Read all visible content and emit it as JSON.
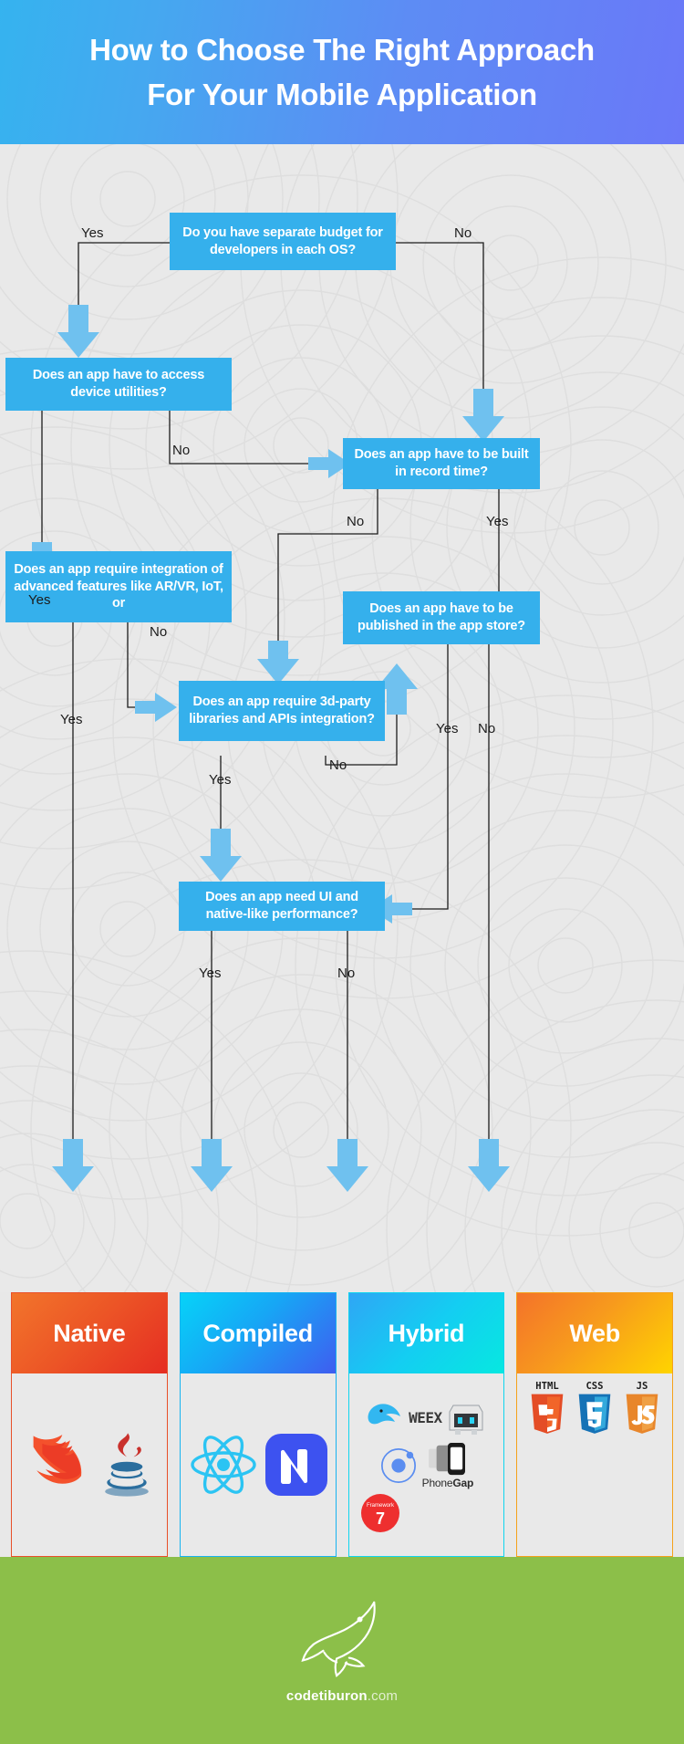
{
  "header": {
    "line1": "How to Choose The Right Approach",
    "line2": "For Your Mobile Application",
    "gradient_from": "#35b3ef",
    "gradient_to": "#6a78f8"
  },
  "flow": {
    "node_color": "#35b0ec",
    "arrow_color": "#6fc1ef",
    "nodes": [
      {
        "id": "budget",
        "text": "Do you have separate budget for developers in each OS?"
      },
      {
        "id": "utilities",
        "text": "Does an app have to access device utilities?"
      },
      {
        "id": "record",
        "text": "Does an app have to be built in record time?"
      },
      {
        "id": "advanced",
        "text": "Does an app require integration of advanced features like AR/VR, IoT, or"
      },
      {
        "id": "store",
        "text": "Does an app have to be published in the app store?"
      },
      {
        "id": "thirdparty",
        "text": "Does an app require 3d-party libraries and APIs integration?"
      },
      {
        "id": "ui",
        "text": "Does an app need UI and native-like performance?"
      }
    ],
    "labels": {
      "budget_yes": "Yes",
      "budget_no": "No",
      "utilities_yes": "Yes",
      "utilities_no": "No",
      "record_no": "No",
      "record_yes": "Yes",
      "advanced_no": "No",
      "advanced_yes": "Yes",
      "thirdparty_yes": "Yes",
      "thirdparty_no": "No",
      "store_yes": "Yes",
      "store_no": "No",
      "ui_yes": "Yes",
      "ui_no": "No"
    }
  },
  "cards": [
    {
      "title": "Native",
      "border": "#e8502a",
      "logos": [
        "swift-logo",
        "java-logo"
      ]
    },
    {
      "title": "Compiled",
      "border": "#16b3f0",
      "logos": [
        "react-native-logo",
        "nativescript-logo"
      ]
    },
    {
      "title": "Hybrid",
      "border": "#0fd5ef",
      "logos": [
        "weex-logo",
        "cordova-logo",
        "ionic-logo",
        "phonegap-logo",
        "framework7-logo"
      ]
    },
    {
      "title": "Web",
      "border": "#f5a11b",
      "logos": [
        "html5-logo",
        "css3-logo",
        "javascript-logo"
      ]
    }
  ],
  "footer": {
    "background": "#8cbf49",
    "logo": "shark-logo",
    "brand_name": "codetiburon",
    "brand_tld": ".com"
  }
}
